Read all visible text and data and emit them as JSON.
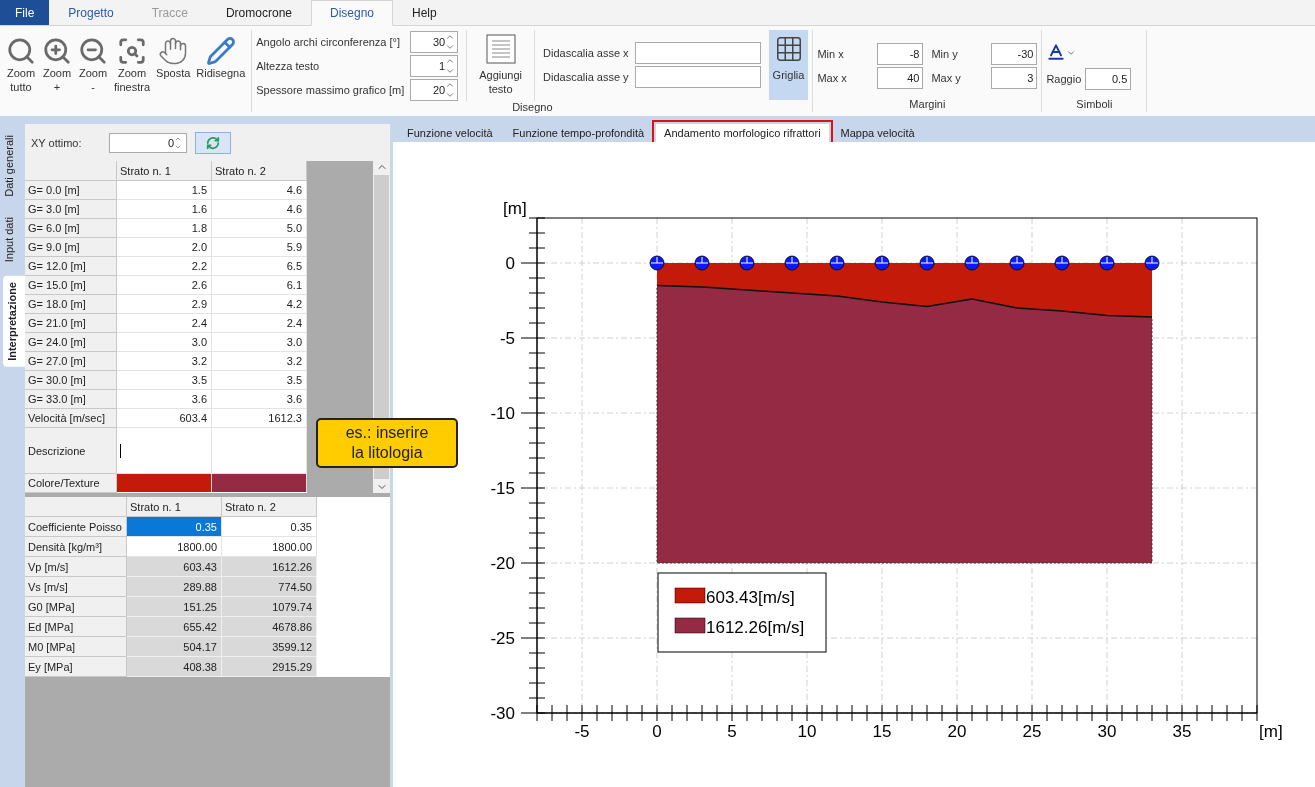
{
  "menu_tabs": [
    {
      "label": "File",
      "kind": "file",
      "selected": false,
      "disabled": false
    },
    {
      "label": "Progetto",
      "kind": "tab",
      "selected": false,
      "disabled": false
    },
    {
      "label": "Tracce",
      "kind": "tab",
      "selected": false,
      "disabled": true
    },
    {
      "label": "Dromocrone",
      "kind": "tab",
      "selected": false,
      "disabled": false
    },
    {
      "label": "Disegno",
      "kind": "tab",
      "selected": true,
      "disabled": false
    },
    {
      "label": "Help",
      "kind": "tab",
      "selected": false,
      "disabled": false
    }
  ],
  "ribbon": {
    "tools": [
      {
        "label": "Zoom\ntutto",
        "disabled": false
      },
      {
        "label": "Zoom\n+",
        "disabled": false
      },
      {
        "label": "Zoom\n-",
        "disabled": false
      },
      {
        "label": "Zoom\nfinestra",
        "disabled": false
      },
      {
        "label": "Sposta",
        "disabled": false
      },
      {
        "label": "Ridisegna",
        "disabled": false
      }
    ],
    "spinners": [
      {
        "label": "Angolo archi circonferenza [°]",
        "value": "30"
      },
      {
        "label": "Altezza testo",
        "value": "1"
      },
      {
        "label": "Spessore massimo grafico [m]",
        "value": "20"
      }
    ],
    "drawing_group": "Disegno",
    "add_text": "Aggiungi\ntesto",
    "caption_fields": [
      {
        "label": "Didascalia asse x"
      },
      {
        "label": "Didascalia asse y"
      }
    ],
    "grid_button": {
      "label": "Griglia",
      "selected": true
    },
    "margin_fields": [
      {
        "label": "Min x",
        "value": "-8"
      },
      {
        "label": "Min y",
        "value": "-30"
      },
      {
        "label": "Max x",
        "value": "40"
      },
      {
        "label": "Max y",
        "value": "3"
      }
    ],
    "margins_group": "Margini",
    "radius": {
      "label": "Raggio",
      "value": "0.5"
    },
    "symbols_group": "Simboli"
  },
  "side_tabs": [
    {
      "label": "Dati generali",
      "selected": false
    },
    {
      "label": "Input dati",
      "selected": false
    },
    {
      "label": "Interpretazione",
      "selected": true
    }
  ],
  "xy_optimum": {
    "label": "XY ottimo:",
    "value": "0"
  },
  "layer_table": {
    "columns": [
      "Strato n. 1",
      "Strato n. 2"
    ],
    "rows": [
      {
        "label": "G= 0.0 [m]",
        "values": [
          "1.5",
          "4.6"
        ]
      },
      {
        "label": "G= 3.0 [m]",
        "values": [
          "1.6",
          "4.6"
        ]
      },
      {
        "label": "G= 6.0 [m]",
        "values": [
          "1.8",
          "5.0"
        ]
      },
      {
        "label": "G= 9.0 [m]",
        "values": [
          "2.0",
          "5.9"
        ]
      },
      {
        "label": "G= 12.0 [m]",
        "values": [
          "2.2",
          "6.5"
        ]
      },
      {
        "label": "G= 15.0 [m]",
        "values": [
          "2.6",
          "6.1"
        ]
      },
      {
        "label": "G= 18.0 [m]",
        "values": [
          "2.9",
          "4.2"
        ]
      },
      {
        "label": "G= 21.0 [m]",
        "values": [
          "2.4",
          "2.4"
        ]
      },
      {
        "label": "G= 24.0 [m]",
        "values": [
          "3.0",
          "3.0"
        ]
      },
      {
        "label": "G= 27.0 [m]",
        "values": [
          "3.2",
          "3.2"
        ]
      },
      {
        "label": "G= 30.0 [m]",
        "values": [
          "3.5",
          "3.5"
        ]
      },
      {
        "label": "G= 33.0 [m]",
        "values": [
          "3.6",
          "3.6"
        ]
      },
      {
        "label": "Velocità [m/sec]",
        "values": [
          "603.4",
          "1612.3"
        ]
      }
    ],
    "description_label": "Descrizione",
    "color_label": "Colore/Texture",
    "swatches": [
      {
        "color": "#c41a0a"
      },
      {
        "color": "#952a44"
      }
    ]
  },
  "callout": "es.: inserire\nla litologia",
  "properties_table": {
    "columns": [
      "Strato n. 1",
      "Strato n. 2"
    ],
    "rows": [
      {
        "label": "Coefficiente Poisso",
        "editable": true,
        "cells": [
          {
            "value": "0.35",
            "selected": true
          },
          {
            "value": "0.35",
            "selected": false
          }
        ]
      },
      {
        "label": "Densità [kg/m³]",
        "editable": true,
        "cells": [
          {
            "value": "1800.00",
            "selected": false
          },
          {
            "value": "1800.00",
            "selected": false
          }
        ]
      },
      {
        "label": "Vp [m/s]",
        "editable": false,
        "cells": [
          {
            "value": "603.43",
            "selected": false
          },
          {
            "value": "1612.26",
            "selected": false
          }
        ]
      },
      {
        "label": "Vs [m/s]",
        "editable": false,
        "cells": [
          {
            "value": "289.88",
            "selected": false
          },
          {
            "value": "774.50",
            "selected": false
          }
        ]
      },
      {
        "label": "G0 [MPa]",
        "editable": false,
        "cells": [
          {
            "value": "151.25",
            "selected": false
          },
          {
            "value": "1079.74",
            "selected": false
          }
        ]
      },
      {
        "label": "Ed [MPa]",
        "editable": false,
        "cells": [
          {
            "value": "655.42",
            "selected": false
          },
          {
            "value": "4678.86",
            "selected": false
          }
        ]
      },
      {
        "label": "M0 [MPa]",
        "editable": false,
        "cells": [
          {
            "value": "504.17",
            "selected": false
          },
          {
            "value": "3599.12",
            "selected": false
          }
        ]
      },
      {
        "label": "Ey [MPa]",
        "editable": false,
        "cells": [
          {
            "value": "408.38",
            "selected": false
          },
          {
            "value": "2915.29",
            "selected": false
          }
        ]
      }
    ]
  },
  "chart_tabs": [
    {
      "label": "Funzione velocità",
      "selected": false,
      "highlighted": false
    },
    {
      "label": "Funzione tempo-profondità",
      "selected": false,
      "highlighted": false
    },
    {
      "label": "Andamento morfologico rifrattori",
      "selected": true,
      "highlighted": true
    },
    {
      "label": "Mappa velocità",
      "selected": false,
      "highlighted": false
    }
  ],
  "chart": {
    "chart_data": {
      "type": "area",
      "grid": true,
      "legend": true,
      "xlabel": "[m]",
      "ylabel": "[m]",
      "xlim": [
        -8,
        40
      ],
      "ylim": [
        -30,
        3
      ],
      "xticks": [
        {
          "value": -5,
          "label": "-5"
        },
        {
          "value": 0,
          "label": "0"
        },
        {
          "value": 5,
          "label": "5"
        },
        {
          "value": 10,
          "label": "10"
        },
        {
          "value": 15,
          "label": "15"
        },
        {
          "value": 20,
          "label": "20"
        },
        {
          "value": 25,
          "label": "25"
        },
        {
          "value": 30,
          "label": "30"
        },
        {
          "value": 35,
          "label": "35"
        }
      ],
      "yticks": [
        {
          "value": -30,
          "label": "-30"
        },
        {
          "value": -25,
          "label": "-25"
        },
        {
          "value": -20,
          "label": "-20"
        },
        {
          "value": -15,
          "label": "-15"
        },
        {
          "value": -10,
          "label": "-10"
        },
        {
          "value": -5,
          "label": "-5"
        },
        {
          "value": 0,
          "label": "0"
        }
      ],
      "x": [
        0,
        3,
        6,
        9,
        12,
        15,
        18,
        21,
        24,
        27,
        30,
        33
      ],
      "series": [
        {
          "name": "603.43[m/s]",
          "color": "#c41a0a",
          "values": [
            -1.5,
            -1.6,
            -1.8,
            -2.0,
            -2.2,
            -2.6,
            -2.9,
            -2.4,
            -3.0,
            -3.2,
            -3.5,
            -3.6
          ]
        },
        {
          "name": "1612.26[m/s]",
          "color": "#952a44",
          "values": [
            -20,
            -20,
            -20,
            -20,
            -20,
            -20,
            -20,
            -20,
            -20,
            -20,
            -20,
            -20
          ]
        }
      ]
    }
  }
}
